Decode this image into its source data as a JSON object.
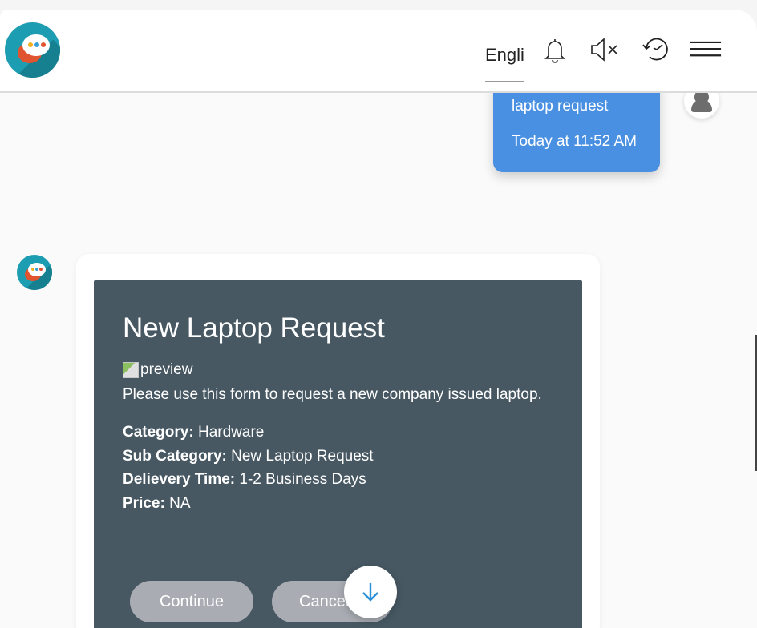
{
  "header": {
    "language": "English",
    "icons": [
      "bell-icon",
      "mute-icon",
      "history-icon",
      "menu-icon"
    ]
  },
  "user_message": {
    "text": "laptop request",
    "time": "Today at 11:52 AM"
  },
  "form_card": {
    "title": "New Laptop Request",
    "image_alt": "preview",
    "description": "Please use this form to request a new company issued laptop.",
    "details": [
      {
        "key": "Category:",
        "value": "Hardware"
      },
      {
        "key": "Sub Category:",
        "value": "New Laptop Request"
      },
      {
        "key": "Delievery Time:",
        "value": "1-2 Business Days"
      },
      {
        "key": "Price:",
        "value": "NA"
      }
    ],
    "buttons": {
      "continue": "Continue",
      "cancel": "Cancel"
    }
  },
  "colors": {
    "accent": "#4a90e2",
    "card": "#475863",
    "brand": "#1d9db2"
  }
}
